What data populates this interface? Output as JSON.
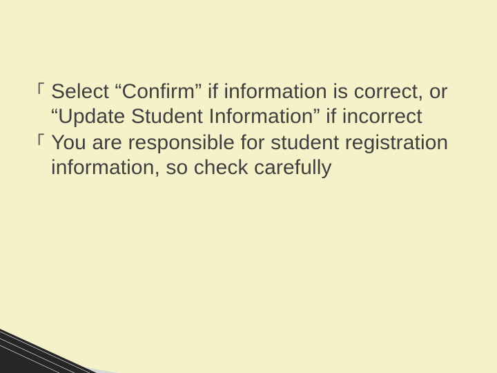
{
  "bullet_glyph": "｢",
  "bullets": [
    {
      "text": "Select “Confirm” if information is correct, or “Update Student Information” if incorrect"
    },
    {
      "text": "You are responsible for student registration information, so check carefully"
    }
  ]
}
